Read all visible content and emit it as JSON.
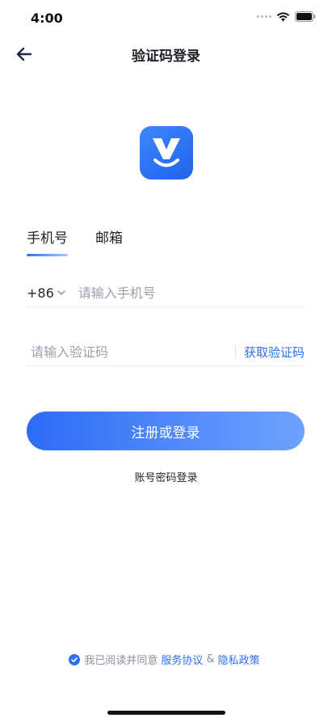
{
  "status_bar": {
    "time": "4:00",
    "icons": [
      "signal-icon",
      "wifi-icon",
      "battery-icon"
    ]
  },
  "nav": {
    "title": "验证码登录",
    "back_icon": "arrow-left-icon"
  },
  "logo": {
    "icon": "app-logo-icon",
    "color": "#2b6ff2"
  },
  "tabs": [
    {
      "label": "手机号",
      "active": true
    },
    {
      "label": "邮箱",
      "active": false
    }
  ],
  "phone": {
    "country_code": "+86",
    "placeholder": "请输入手机号",
    "value": ""
  },
  "code": {
    "placeholder": "请输入验证码",
    "value": "",
    "get_code_label": "获取验证码"
  },
  "submit_label": "注册或登录",
  "password_login_label": "账号密码登录",
  "agreement": {
    "checked": true,
    "prefix": "我已阅读并同意",
    "service_label": "服务协议",
    "separator": "&",
    "privacy_label": "隐私政策"
  },
  "colors": {
    "accent": "#2f6ff0",
    "text": "#1f2329",
    "placeholder": "#9aa1ad"
  }
}
